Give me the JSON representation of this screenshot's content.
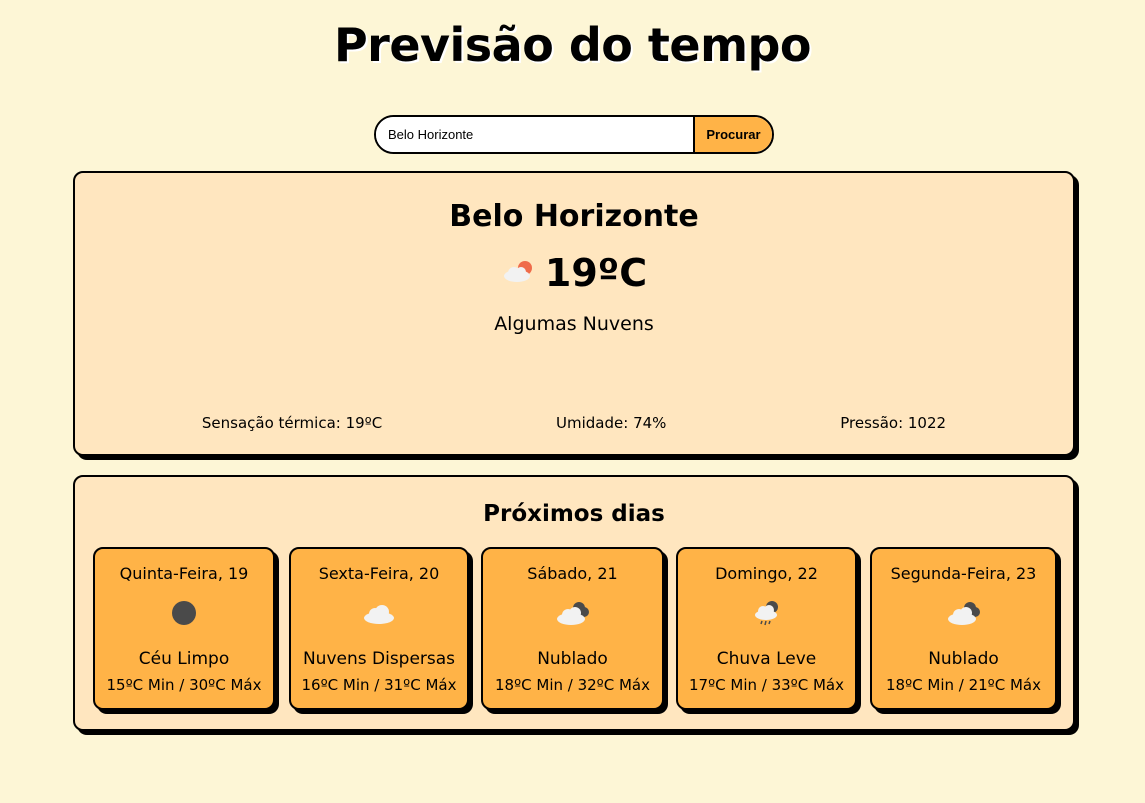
{
  "page": {
    "title": "Previsão do tempo"
  },
  "search": {
    "value": "Belo Horizonte",
    "button_label": "Procurar"
  },
  "current": {
    "city": "Belo Horizonte",
    "temperature": "19ºC",
    "icon": "few-clouds-day-icon",
    "description": "Algumas Nuvens",
    "feels_like": "Sensação térmica: 19ºC",
    "humidity": "Umidade: 74%",
    "pressure": "Pressão: 1022"
  },
  "forecast": {
    "title": "Próximos dias",
    "days": [
      {
        "name": "Quinta-Feira, 19",
        "icon": "clear-night-icon",
        "description": "Céu Limpo",
        "range": "15ºC Min / 30ºC Máx"
      },
      {
        "name": "Sexta-Feira, 20",
        "icon": "scattered-clouds-icon",
        "description": "Nuvens Dispersas",
        "range": "16ºC Min / 31ºC Máx"
      },
      {
        "name": "Sábado, 21",
        "icon": "overcast-clouds-icon",
        "description": "Nublado",
        "range": "18ºC Min / 32ºC Máx"
      },
      {
        "name": "Domingo, 22",
        "icon": "light-rain-icon",
        "description": "Chuva Leve",
        "range": "17ºC Min / 33ºC Máx"
      },
      {
        "name": "Segunda-Feira, 23",
        "icon": "overcast-clouds-icon",
        "description": "Nublado",
        "range": "18ºC Min / 21ºC Máx"
      }
    ]
  },
  "colors": {
    "background": "#fdf6d6",
    "panel": "#ffe6bf",
    "card": "#ffb347",
    "border": "#000000"
  }
}
